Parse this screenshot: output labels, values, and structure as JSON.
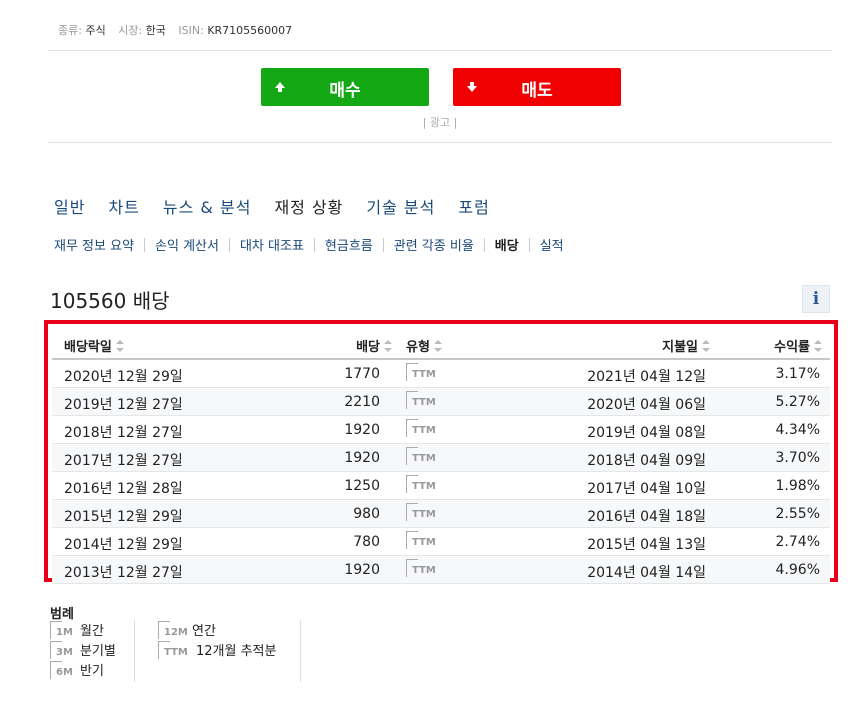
{
  "meta": {
    "type_label": "종류:",
    "type_value": "주식",
    "market_label": "시장:",
    "market_value": "한국",
    "isin_label": "ISIN:",
    "isin_value": "KR7105560007"
  },
  "actions": {
    "buy_label": "매수",
    "sell_label": "매도",
    "ad_label": "| 광고 |"
  },
  "colors": {
    "buy": "#14a814",
    "sell": "#f00000",
    "highlight_border": "#e8001a",
    "link": "#1a4a7a"
  },
  "tabs": [
    {
      "label": "일반"
    },
    {
      "label": "차트"
    },
    {
      "label": "뉴스 & 분석"
    },
    {
      "label": "재정 상황"
    },
    {
      "label": "기술 분석"
    },
    {
      "label": "포럼"
    }
  ],
  "subtabs": [
    {
      "label": "재무 정보 요약"
    },
    {
      "label": "손익 계산서"
    },
    {
      "label": "대차 대조표"
    },
    {
      "label": "현금흐름"
    },
    {
      "label": "관련 각종 비율"
    },
    {
      "label": "배당"
    },
    {
      "label": "실적"
    }
  ],
  "page": {
    "title": "105560 배당",
    "info_icon": "i"
  },
  "table": {
    "headers": {
      "ex_date": "배당락일",
      "dividend": "배당",
      "type": "유형",
      "pay_date": "지불일",
      "yield": "수익률"
    },
    "rows": [
      {
        "ex_date": "2020년 12월 29일",
        "dividend": "1770",
        "type": "TTM",
        "pay_date": "2021년 04월 12일",
        "yield": "3.17%"
      },
      {
        "ex_date": "2019년 12월 27일",
        "dividend": "2210",
        "type": "TTM",
        "pay_date": "2020년 04월 06일",
        "yield": "5.27%"
      },
      {
        "ex_date": "2018년 12월 27일",
        "dividend": "1920",
        "type": "TTM",
        "pay_date": "2019년 04월 08일",
        "yield": "4.34%"
      },
      {
        "ex_date": "2017년 12월 27일",
        "dividend": "1920",
        "type": "TTM",
        "pay_date": "2018년 04월 09일",
        "yield": "3.70%"
      },
      {
        "ex_date": "2016년 12월 28일",
        "dividend": "1250",
        "type": "TTM",
        "pay_date": "2017년 04월 10일",
        "yield": "1.98%"
      },
      {
        "ex_date": "2015년 12월 29일",
        "dividend": "980",
        "type": "TTM",
        "pay_date": "2016년 04월 18일",
        "yield": "2.55%"
      },
      {
        "ex_date": "2014년 12월 29일",
        "dividend": "780",
        "type": "TTM",
        "pay_date": "2015년 04월 13일",
        "yield": "2.74%"
      },
      {
        "ex_date": "2013년 12월 27일",
        "dividend": "1920",
        "type": "TTM",
        "pay_date": "2014년 04월 14일",
        "yield": "4.96%"
      }
    ]
  },
  "legend": {
    "title": "범례",
    "items": [
      {
        "badge": "1M",
        "label": "월간"
      },
      {
        "badge": "3M",
        "label": "분기별"
      },
      {
        "badge": "6M",
        "label": "반기"
      },
      {
        "badge": "12M",
        "label": "연간"
      },
      {
        "badge": "TTM",
        "label": "12개월 추적분"
      }
    ]
  }
}
